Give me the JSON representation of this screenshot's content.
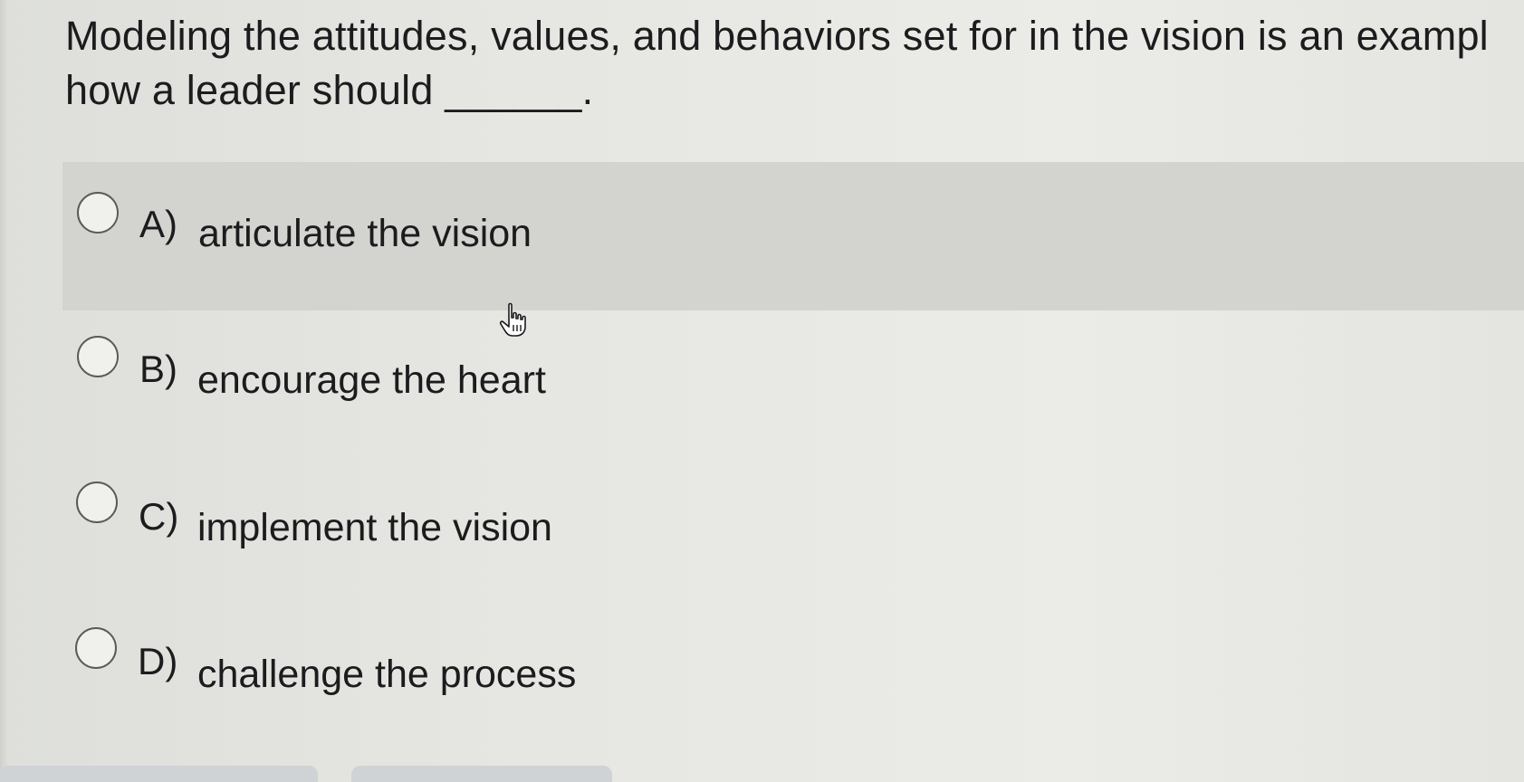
{
  "question": {
    "line1": "Modeling the attitudes, values, and behaviors set for in the vision is an exampl",
    "line2": "how a leader should ______."
  },
  "options": [
    {
      "letter": "A)",
      "text": "articulate the vision",
      "highlighted": true
    },
    {
      "letter": "B)",
      "text": "encourage the heart",
      "highlighted": false
    },
    {
      "letter": "C)",
      "text": "implement the vision",
      "highlighted": false
    },
    {
      "letter": "D)",
      "text": "challenge the process",
      "highlighted": false
    }
  ],
  "icons": {
    "cursor": "pointer-hand-cursor-icon",
    "radio": "radio-button-icon"
  },
  "colors": {
    "highlight_row": "#d3d4d0",
    "background": "#e6e6e2",
    "text": "#1c1c1e"
  }
}
